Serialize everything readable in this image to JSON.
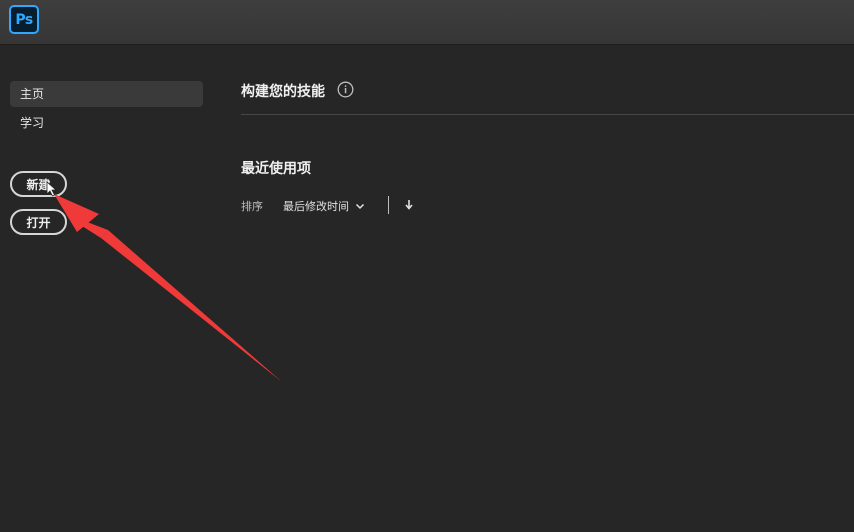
{
  "app": {
    "logo_text": "Ps"
  },
  "sidebar": {
    "items": [
      {
        "label": "主页",
        "active": true
      },
      {
        "label": "学习",
        "active": false
      }
    ],
    "new_button": "新建",
    "open_button": "打开"
  },
  "main": {
    "skills_title": "构建您的技能",
    "recent_title": "最近使用项",
    "sort": {
      "label": "排序",
      "selected": "最后修改时间"
    }
  },
  "colors": {
    "accent": "#31a8ff",
    "annotation_arrow": "#f03a3a"
  }
}
